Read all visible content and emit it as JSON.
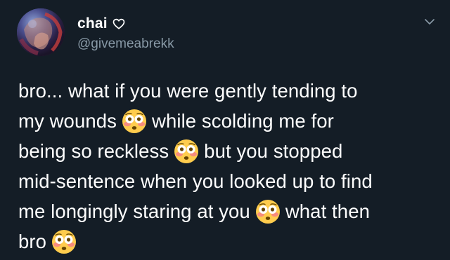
{
  "author": {
    "display_name": "chai",
    "name_icon": "heart-outline-icon",
    "handle": "@givemeabrekk"
  },
  "menu": {
    "icon": "chevron-down-icon"
  },
  "tweet": {
    "emoji_icon": "flushed-face-icon",
    "line1": {
      "text": "bro... what if you were gently tending to"
    },
    "line2": {
      "before": "my wounds",
      "after": "while scolding me for"
    },
    "line3": {
      "before": "being so reckless",
      "after": "but you stopped"
    },
    "line4": {
      "text": "mid-sentence when you looked up to find"
    },
    "line5": {
      "before": "me longingly staring at you",
      "after": "what then"
    },
    "line6": {
      "before": "bro"
    }
  },
  "colors": {
    "background": "#141d26",
    "primary_text": "#ffffff",
    "secondary_text": "#8899a6",
    "emoji_face": "#ffcc4d"
  }
}
